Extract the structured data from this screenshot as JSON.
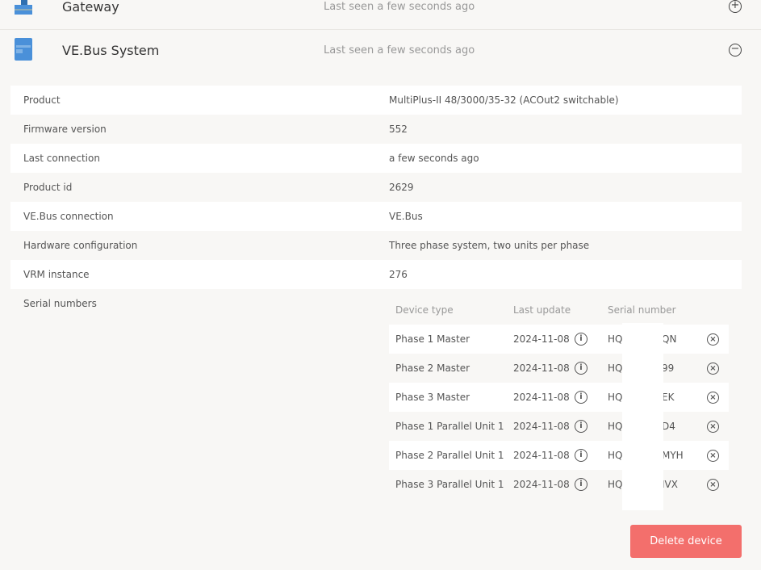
{
  "devices": [
    {
      "name": "Gateway",
      "last_seen": "Last seen a few seconds ago",
      "toggle": "+"
    },
    {
      "name": "VE.Bus System",
      "last_seen": "Last seen a few seconds ago",
      "toggle": "−"
    }
  ],
  "details": [
    {
      "label": "Product",
      "value": "MultiPlus-II 48/3000/35-32 (ACOut2 switchable)"
    },
    {
      "label": "Firmware version",
      "value": "552"
    },
    {
      "label": "Last connection",
      "value": "a few seconds ago"
    },
    {
      "label": "Product id",
      "value": "2629"
    },
    {
      "label": "VE.Bus connection",
      "value": "VE.Bus"
    },
    {
      "label": "Hardware configuration",
      "value": "Three phase system, two units per phase"
    },
    {
      "label": "VRM instance",
      "value": "276"
    }
  ],
  "serials": {
    "label": "Serial numbers",
    "headers": {
      "type": "Device type",
      "update": "Last update",
      "serial": "Serial number"
    },
    "rows": [
      {
        "type": "Phase 1 Master",
        "update": "2024-11-08",
        "prefix": "HQ",
        "suffix": "QN"
      },
      {
        "type": "Phase 2 Master",
        "update": "2024-11-08",
        "prefix": "HQ",
        "suffix": "99"
      },
      {
        "type": "Phase 3 Master",
        "update": "2024-11-08",
        "prefix": "HQ",
        "suffix": "EK"
      },
      {
        "type": "Phase 1 Parallel Unit 1",
        "update": "2024-11-08",
        "prefix": "HQ",
        "suffix": "D4"
      },
      {
        "type": "Phase 2 Parallel Unit 1",
        "update": "2024-11-08",
        "prefix": "HQ",
        "suffix": "MYH"
      },
      {
        "type": "Phase 3 Parallel Unit 1",
        "update": "2024-11-08",
        "prefix": "HQ",
        "suffix": "IVX"
      }
    ]
  },
  "icons": {
    "info": "i",
    "remove": "×"
  },
  "delete_label": "Delete device",
  "colors": {
    "accent": "#f36f6c",
    "device_icon": "#4a90d9"
  }
}
